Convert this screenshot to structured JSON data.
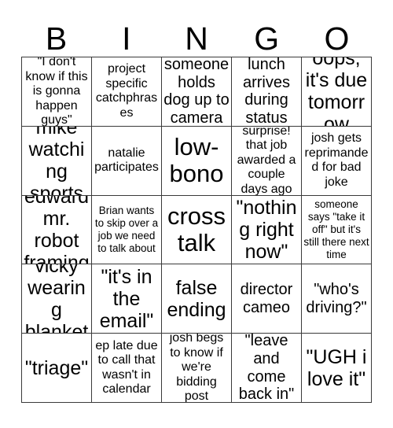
{
  "header": {
    "letters": [
      "B",
      "I",
      "N",
      "G",
      "O"
    ]
  },
  "grid": {
    "rows": [
      [
        {
          "text": "\"I don't know if this is gonna happen guys\"",
          "size": "s-sm"
        },
        {
          "text": "project specific catchphrases",
          "size": "s-sm"
        },
        {
          "text": "someone holds dog up to camera",
          "size": "s-md"
        },
        {
          "text": "lunch arrives during status",
          "size": "s-md"
        },
        {
          "text": "oops, it's due tomorrow",
          "size": "s-lg"
        }
      ],
      [
        {
          "text": "mike watching sports",
          "size": "s-lg"
        },
        {
          "text": "natalie participates",
          "size": "s-sm"
        },
        {
          "text": "low-bono",
          "size": "s-xl"
        },
        {
          "text": "surprise! that job awarded a couple days ago",
          "size": "s-sm"
        },
        {
          "text": "josh gets reprimanded for bad joke",
          "size": "s-sm"
        }
      ],
      [
        {
          "text": "edward mr. robot framing",
          "size": "s-lg"
        },
        {
          "text": "Brian wants to skip over a job we need to talk about",
          "size": "s-xs"
        },
        {
          "text": "cross talk",
          "size": "s-xl"
        },
        {
          "text": "\"nothing right now\"",
          "size": "s-lg"
        },
        {
          "text": "someone says \"take it off\" but it's still there next time",
          "size": "s-xs"
        }
      ],
      [
        {
          "text": "vicky wearing blanket",
          "size": "s-lg"
        },
        {
          "text": "\"it's in the email\"",
          "size": "s-lg"
        },
        {
          "text": "false ending",
          "size": "s-lg"
        },
        {
          "text": "director cameo",
          "size": "s-md"
        },
        {
          "text": "\"who's driving?\"",
          "size": "s-md"
        }
      ],
      [
        {
          "text": "\"triage\"",
          "size": "s-lg"
        },
        {
          "text": "ep late due to call that wasn't in calendar",
          "size": "s-sm"
        },
        {
          "text": "josh begs to know if we're bidding post",
          "size": "s-sm"
        },
        {
          "text": "\"leave and come back in\"",
          "size": "s-md"
        },
        {
          "text": "\"UGH i love it\"",
          "size": "s-lg"
        }
      ]
    ]
  }
}
